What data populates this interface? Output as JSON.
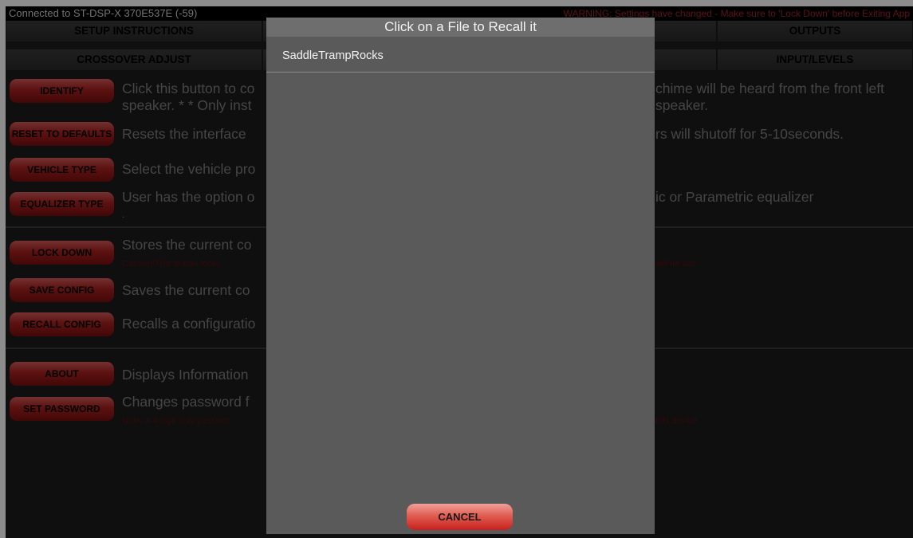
{
  "status_bar": {
    "connection": "Connected to ST-DSP-X  370E537E (-59)",
    "warning": "WARNING: Settings have changed - Make sure to 'Lock Down' before Exiting App"
  },
  "tabs_row1": [
    "SETUP INSTRUCTIONS",
    "",
    "",
    "OUTPUTS"
  ],
  "tabs_row2": [
    "CROSSOVER ADJUST",
    "",
    "",
    "INPUT/LEVELS"
  ],
  "rows": [
    {
      "button": "IDENTIFY",
      "desc": [
        "Click this button to co",
        "speaker. * * Only inst"
      ],
      "desc_right": [
        "chime will be heard from the front left",
        "speaker."
      ]
    },
    {
      "button": "RESET TO DEFAULTS",
      "desc": [
        "Resets the interface"
      ],
      "desc_right": [
        "rs will shutoff for 5-10seconds."
      ]
    },
    {
      "button": "VEHICLE TYPE",
      "desc": [
        "Select the vehicle pro"
      ]
    },
    {
      "button": "EQUALIZER TYPE",
      "desc": [
        "User has the option o",
        "."
      ],
      "desc_right": [
        "ic or Parametric equalizer"
      ]
    },
    {
      "button": "LOCK DOWN",
      "desc": [
        "Stores the current co"
      ],
      "note_left": "Caution!This button locks",
      "note_right": "will be lost"
    },
    {
      "button": "SAVE CONFIG",
      "desc": [
        "Saves the current co"
      ]
    },
    {
      "button": "RECALL CONFIG",
      "desc": [
        "Recalls a configuratio"
      ]
    },
    {
      "button": "ABOUT",
      "desc": [
        "Displays Information"
      ]
    },
    {
      "button": "SET PASSWORD",
      "desc": [
        "Changes password f"
      ],
      "note_left": "Note: A 4 digit only passwor",
      "note_right": "this device"
    }
  ],
  "dialog": {
    "title": "Click on a File to Recall it",
    "files": [
      "SaddleTrampRocks"
    ],
    "cancel_label": "CANCEL"
  }
}
